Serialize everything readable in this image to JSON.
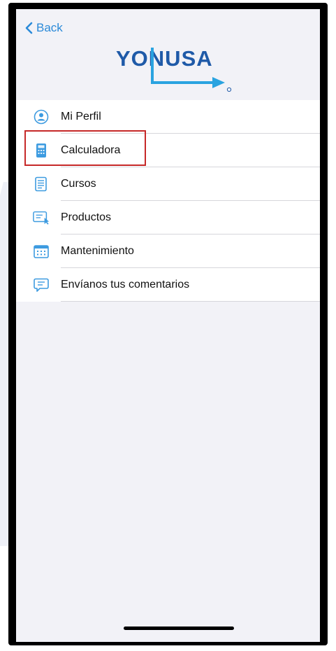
{
  "nav": {
    "back_label": "Back"
  },
  "logo": {
    "text": "YONUSA"
  },
  "menu": {
    "items": [
      {
        "label": "Mi Perfil",
        "icon": "profile-icon"
      },
      {
        "label": "Calculadora",
        "icon": "calculator-icon"
      },
      {
        "label": "Cursos",
        "icon": "courses-icon"
      },
      {
        "label": "Productos",
        "icon": "products-icon"
      },
      {
        "label": "Mantenimiento",
        "icon": "calendar-icon"
      },
      {
        "label": "Envíanos tus comentarios",
        "icon": "comment-icon"
      }
    ]
  },
  "colors": {
    "accent": "#2b8ad8",
    "brand": "#1f5aa8",
    "highlight": "#c62828"
  }
}
